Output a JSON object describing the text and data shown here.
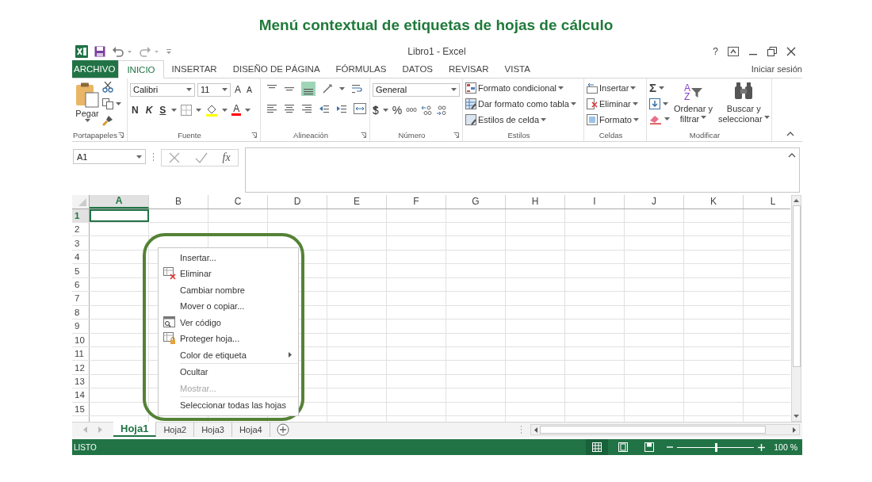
{
  "title": "Menú contextual de etiquetas de hojas de cálculo",
  "window": {
    "title": "Libro1 - Excel",
    "help": "?"
  },
  "menu_tabs": [
    {
      "label": "ARCHIVO",
      "kind": "file",
      "selected": false
    },
    {
      "label": "INICIO",
      "kind": "tab",
      "selected": true
    },
    {
      "label": "INSERTAR",
      "kind": "tab",
      "selected": false
    },
    {
      "label": "DISEÑO DE PÁGINA",
      "kind": "tab",
      "selected": false
    },
    {
      "label": "FÓRMULAS",
      "kind": "tab",
      "selected": false
    },
    {
      "label": "DATOS",
      "kind": "tab",
      "selected": false
    },
    {
      "label": "REVISAR",
      "kind": "tab",
      "selected": false
    },
    {
      "label": "VISTA",
      "kind": "tab",
      "selected": false
    }
  ],
  "sign_in": "Iniciar sesión",
  "ribbon": {
    "clipboard": {
      "paste": "Pegar",
      "label": "Portapapeles"
    },
    "font": {
      "name": "Calibri",
      "size": "11",
      "grow": "A",
      "shrink": "A",
      "bold": "N",
      "italic": "K",
      "underline": "S",
      "color_letter": "A",
      "label": "Fuente"
    },
    "alignment": {
      "label": "Alineación"
    },
    "number": {
      "format": "General",
      "currency": "$",
      "percent": "%",
      "thousands": "000",
      "label": "Número"
    },
    "styles": {
      "items": [
        "Formato condicional",
        "Dar formato como tabla",
        "Estilos de celda"
      ],
      "label": "Estilos"
    },
    "cells": {
      "items": [
        "Insertar",
        "Eliminar",
        "Formato"
      ],
      "label": "Celdas"
    },
    "editing": {
      "sum": "Σ",
      "sort_letters": [
        "A",
        "Z"
      ],
      "sort": [
        "Ordenar y",
        "filtrar"
      ],
      "find": [
        "Buscar y",
        "seleccionar"
      ],
      "label": "Modificar"
    }
  },
  "name_box": "A1",
  "fx": "fx",
  "columns": [
    {
      "label": "A",
      "selected": true
    },
    {
      "label": "B",
      "selected": false
    },
    {
      "label": "C",
      "selected": false
    },
    {
      "label": "D",
      "selected": false
    },
    {
      "label": "E",
      "selected": false
    },
    {
      "label": "F",
      "selected": false
    },
    {
      "label": "G",
      "selected": false
    },
    {
      "label": "H",
      "selected": false
    },
    {
      "label": "I",
      "selected": false
    },
    {
      "label": "J",
      "selected": false
    },
    {
      "label": "K",
      "selected": false
    },
    {
      "label": "L",
      "selected": false
    }
  ],
  "rows": [
    {
      "label": "1",
      "selected": true
    },
    {
      "label": "2",
      "selected": false
    },
    {
      "label": "3",
      "selected": false
    },
    {
      "label": "4",
      "selected": false
    },
    {
      "label": "5",
      "selected": false
    },
    {
      "label": "6",
      "selected": false
    },
    {
      "label": "7",
      "selected": false
    },
    {
      "label": "8",
      "selected": false
    },
    {
      "label": "9",
      "selected": false
    },
    {
      "label": "10",
      "selected": false
    },
    {
      "label": "11",
      "selected": false
    },
    {
      "label": "12",
      "selected": false
    },
    {
      "label": "13",
      "selected": false
    },
    {
      "label": "14",
      "selected": false
    },
    {
      "label": "15",
      "selected": false
    }
  ],
  "context_menu": [
    {
      "label": "Insertar...",
      "disabled": false
    },
    {
      "label": "Eliminar",
      "kind": "delete",
      "disabled": false
    },
    {
      "label": "Cambiar nombre",
      "disabled": false
    },
    {
      "label": "Mover o copiar...",
      "disabled": false
    },
    {
      "label": "Ver código",
      "kind": "code",
      "disabled": false
    },
    {
      "label": "Proteger hoja...",
      "kind": "protect",
      "disabled": false
    },
    {
      "label": "Color de etiqueta",
      "submenu": true,
      "disabled": false
    },
    {
      "label": "Ocultar",
      "separator_before": true,
      "disabled": false
    },
    {
      "label": "Mostrar...",
      "disabled": true
    },
    {
      "label": "Seleccionar todas las hojas",
      "separator_before": true,
      "disabled": false
    }
  ],
  "sheet_tabs": [
    {
      "label": "Hoja1",
      "selected": true
    },
    {
      "label": "Hoja2",
      "selected": false
    },
    {
      "label": "Hoja3",
      "selected": false
    },
    {
      "label": "Hoja4",
      "selected": false
    }
  ],
  "status_bar": {
    "text": "LISTO",
    "views": [
      {
        "kind": "normal",
        "selected": true
      },
      {
        "kind": "layout",
        "selected": false
      },
      {
        "kind": "pagebreak",
        "selected": false
      }
    ],
    "zoom": {
      "level": 0.5,
      "reading": "100 %"
    }
  }
}
